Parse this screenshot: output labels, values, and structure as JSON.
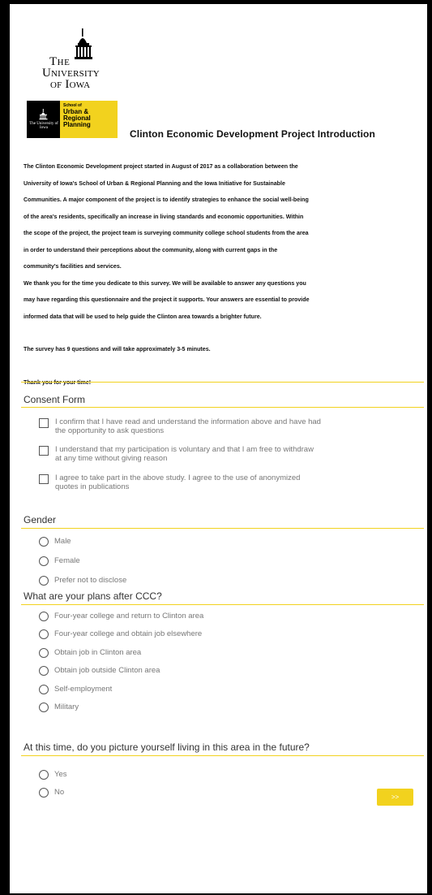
{
  "logo": {
    "line1": "The",
    "line2": "University",
    "line3": "of Iowa"
  },
  "surp_logo": {
    "mini": "The University of Iowa",
    "school_of": "School of",
    "name": "Urban & Regional Planning"
  },
  "survey_title": "Clinton Economic Development Project Introduction",
  "intro": {
    "lines": [
      "The Clinton Economic Development project started in August of 2017 as a collaboration between the",
      "University of Iowa's School of Urban & Regional Planning and the Iowa Initiative for Sustainable",
      "Communities. A major component of the project is to identify strategies to enhance the social well-being",
      "of the area's residents, specifically an increase in living standards and economic opportunities. Within",
      "the scope of the project, the project team is surveying community college school students from the area",
      "in order to understand their perceptions about the community, along with current gaps in the",
      "community's facilities and services.",
      "We thank you for the time you dedicate to this survey. We will be available to answer any questions you",
      "may have regarding this questionnaire and the project it supports. Your answers are essential to provide",
      "informed data that will be used to help guide the Clinton area towards a brighter future."
    ],
    "duration": "The survey has 9 questions and will take approximately 3-5 minutes.",
    "thanks": "Thank you for your time!"
  },
  "consent": {
    "title": "Consent Form",
    "options": [
      [
        "I confirm that I have read and understand the information above and have had",
        "the opportunity to ask questions"
      ],
      [
        "I understand that my participation is voluntary and that I am free to withdraw",
        "at any time without giving reason"
      ],
      [
        "I agree to take part in the above study. I agree to the use of anonymized",
        "quotes in publications"
      ]
    ]
  },
  "gender": {
    "title": "Gender",
    "options": [
      "Male",
      "Female",
      "Prefer not to disclose"
    ]
  },
  "plans": {
    "title": "What are your plans after CCC?",
    "options": [
      "Four-year college and return to Clinton area",
      "Four-year college and obtain job elsewhere",
      "Obtain job in Clinton area",
      "Obtain job outside Clinton area",
      "Self-employment",
      "Military"
    ]
  },
  "future": {
    "title": "At this time, do you picture yourself living in this area in the future?",
    "options": [
      "Yes",
      "No"
    ]
  },
  "next_button": ">>",
  "colors": {
    "accent": "#f2d21e",
    "frame": "#000000"
  }
}
